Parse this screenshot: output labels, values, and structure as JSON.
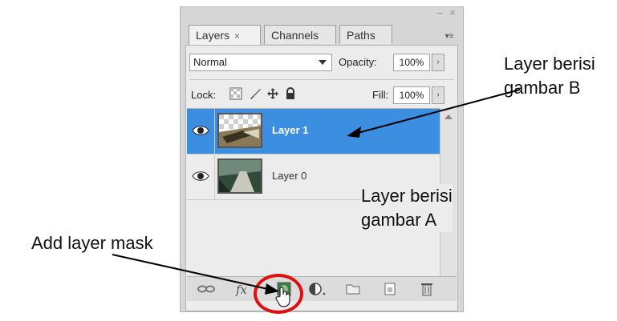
{
  "panel": {
    "tabs": [
      {
        "label": "Layers",
        "close": "×"
      },
      {
        "label": "Channels"
      },
      {
        "label": "Paths"
      }
    ],
    "window_controls": {
      "minimize": "–",
      "close": "×"
    },
    "blend_mode": "Normal",
    "opacity_label": "Opacity:",
    "opacity_value": "100%",
    "lock_label": "Lock:",
    "fill_label": "Fill:",
    "fill_value": "100%",
    "layers": [
      {
        "name": "Layer 1",
        "selected": true,
        "visible": true
      },
      {
        "name": "Layer 0",
        "selected": false,
        "visible": true
      }
    ],
    "bottom_icons": [
      "link-icon",
      "fx-icon",
      "layer-mask-icon",
      "adjustment-layer-icon",
      "folder-icon",
      "new-layer-icon",
      "trash-icon"
    ],
    "selection_color": "#3b8ee0"
  },
  "annotations": {
    "layer_b": [
      "Layer berisi",
      "gambar B"
    ],
    "layer_a": [
      "Layer berisi",
      "gambar A"
    ],
    "mask": "Add layer mask"
  }
}
